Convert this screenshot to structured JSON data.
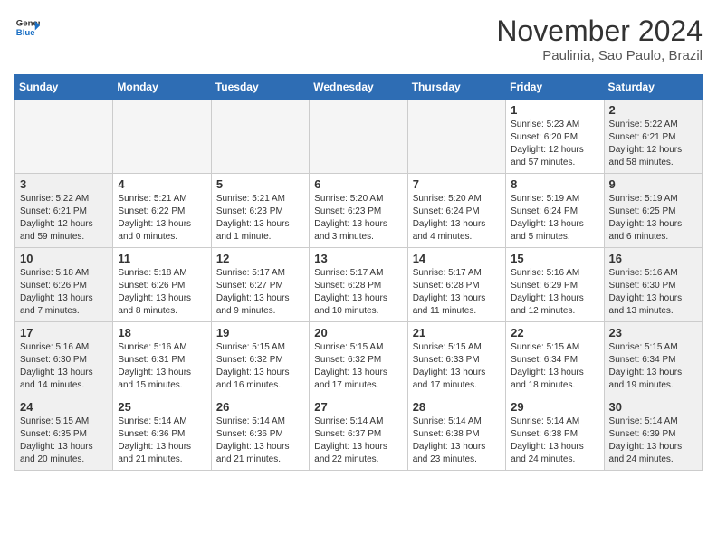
{
  "logo": {
    "line1": "General",
    "line2": "Blue"
  },
  "title": "November 2024",
  "location": "Paulinia, Sao Paulo, Brazil",
  "weekdays": [
    "Sunday",
    "Monday",
    "Tuesday",
    "Wednesday",
    "Thursday",
    "Friday",
    "Saturday"
  ],
  "weeks": [
    [
      {
        "day": "",
        "info": ""
      },
      {
        "day": "",
        "info": ""
      },
      {
        "day": "",
        "info": ""
      },
      {
        "day": "",
        "info": ""
      },
      {
        "day": "",
        "info": ""
      },
      {
        "day": "1",
        "info": "Sunrise: 5:23 AM\nSunset: 6:20 PM\nDaylight: 12 hours\nand 57 minutes."
      },
      {
        "day": "2",
        "info": "Sunrise: 5:22 AM\nSunset: 6:21 PM\nDaylight: 12 hours\nand 58 minutes."
      }
    ],
    [
      {
        "day": "3",
        "info": "Sunrise: 5:22 AM\nSunset: 6:21 PM\nDaylight: 12 hours\nand 59 minutes."
      },
      {
        "day": "4",
        "info": "Sunrise: 5:21 AM\nSunset: 6:22 PM\nDaylight: 13 hours\nand 0 minutes."
      },
      {
        "day": "5",
        "info": "Sunrise: 5:21 AM\nSunset: 6:23 PM\nDaylight: 13 hours\nand 1 minute."
      },
      {
        "day": "6",
        "info": "Sunrise: 5:20 AM\nSunset: 6:23 PM\nDaylight: 13 hours\nand 3 minutes."
      },
      {
        "day": "7",
        "info": "Sunrise: 5:20 AM\nSunset: 6:24 PM\nDaylight: 13 hours\nand 4 minutes."
      },
      {
        "day": "8",
        "info": "Sunrise: 5:19 AM\nSunset: 6:24 PM\nDaylight: 13 hours\nand 5 minutes."
      },
      {
        "day": "9",
        "info": "Sunrise: 5:19 AM\nSunset: 6:25 PM\nDaylight: 13 hours\nand 6 minutes."
      }
    ],
    [
      {
        "day": "10",
        "info": "Sunrise: 5:18 AM\nSunset: 6:26 PM\nDaylight: 13 hours\nand 7 minutes."
      },
      {
        "day": "11",
        "info": "Sunrise: 5:18 AM\nSunset: 6:26 PM\nDaylight: 13 hours\nand 8 minutes."
      },
      {
        "day": "12",
        "info": "Sunrise: 5:17 AM\nSunset: 6:27 PM\nDaylight: 13 hours\nand 9 minutes."
      },
      {
        "day": "13",
        "info": "Sunrise: 5:17 AM\nSunset: 6:28 PM\nDaylight: 13 hours\nand 10 minutes."
      },
      {
        "day": "14",
        "info": "Sunrise: 5:17 AM\nSunset: 6:28 PM\nDaylight: 13 hours\nand 11 minutes."
      },
      {
        "day": "15",
        "info": "Sunrise: 5:16 AM\nSunset: 6:29 PM\nDaylight: 13 hours\nand 12 minutes."
      },
      {
        "day": "16",
        "info": "Sunrise: 5:16 AM\nSunset: 6:30 PM\nDaylight: 13 hours\nand 13 minutes."
      }
    ],
    [
      {
        "day": "17",
        "info": "Sunrise: 5:16 AM\nSunset: 6:30 PM\nDaylight: 13 hours\nand 14 minutes."
      },
      {
        "day": "18",
        "info": "Sunrise: 5:16 AM\nSunset: 6:31 PM\nDaylight: 13 hours\nand 15 minutes."
      },
      {
        "day": "19",
        "info": "Sunrise: 5:15 AM\nSunset: 6:32 PM\nDaylight: 13 hours\nand 16 minutes."
      },
      {
        "day": "20",
        "info": "Sunrise: 5:15 AM\nSunset: 6:32 PM\nDaylight: 13 hours\nand 17 minutes."
      },
      {
        "day": "21",
        "info": "Sunrise: 5:15 AM\nSunset: 6:33 PM\nDaylight: 13 hours\nand 17 minutes."
      },
      {
        "day": "22",
        "info": "Sunrise: 5:15 AM\nSunset: 6:34 PM\nDaylight: 13 hours\nand 18 minutes."
      },
      {
        "day": "23",
        "info": "Sunrise: 5:15 AM\nSunset: 6:34 PM\nDaylight: 13 hours\nand 19 minutes."
      }
    ],
    [
      {
        "day": "24",
        "info": "Sunrise: 5:15 AM\nSunset: 6:35 PM\nDaylight: 13 hours\nand 20 minutes."
      },
      {
        "day": "25",
        "info": "Sunrise: 5:14 AM\nSunset: 6:36 PM\nDaylight: 13 hours\nand 21 minutes."
      },
      {
        "day": "26",
        "info": "Sunrise: 5:14 AM\nSunset: 6:36 PM\nDaylight: 13 hours\nand 21 minutes."
      },
      {
        "day": "27",
        "info": "Sunrise: 5:14 AM\nSunset: 6:37 PM\nDaylight: 13 hours\nand 22 minutes."
      },
      {
        "day": "28",
        "info": "Sunrise: 5:14 AM\nSunset: 6:38 PM\nDaylight: 13 hours\nand 23 minutes."
      },
      {
        "day": "29",
        "info": "Sunrise: 5:14 AM\nSunset: 6:38 PM\nDaylight: 13 hours\nand 24 minutes."
      },
      {
        "day": "30",
        "info": "Sunrise: 5:14 AM\nSunset: 6:39 PM\nDaylight: 13 hours\nand 24 minutes."
      }
    ]
  ]
}
